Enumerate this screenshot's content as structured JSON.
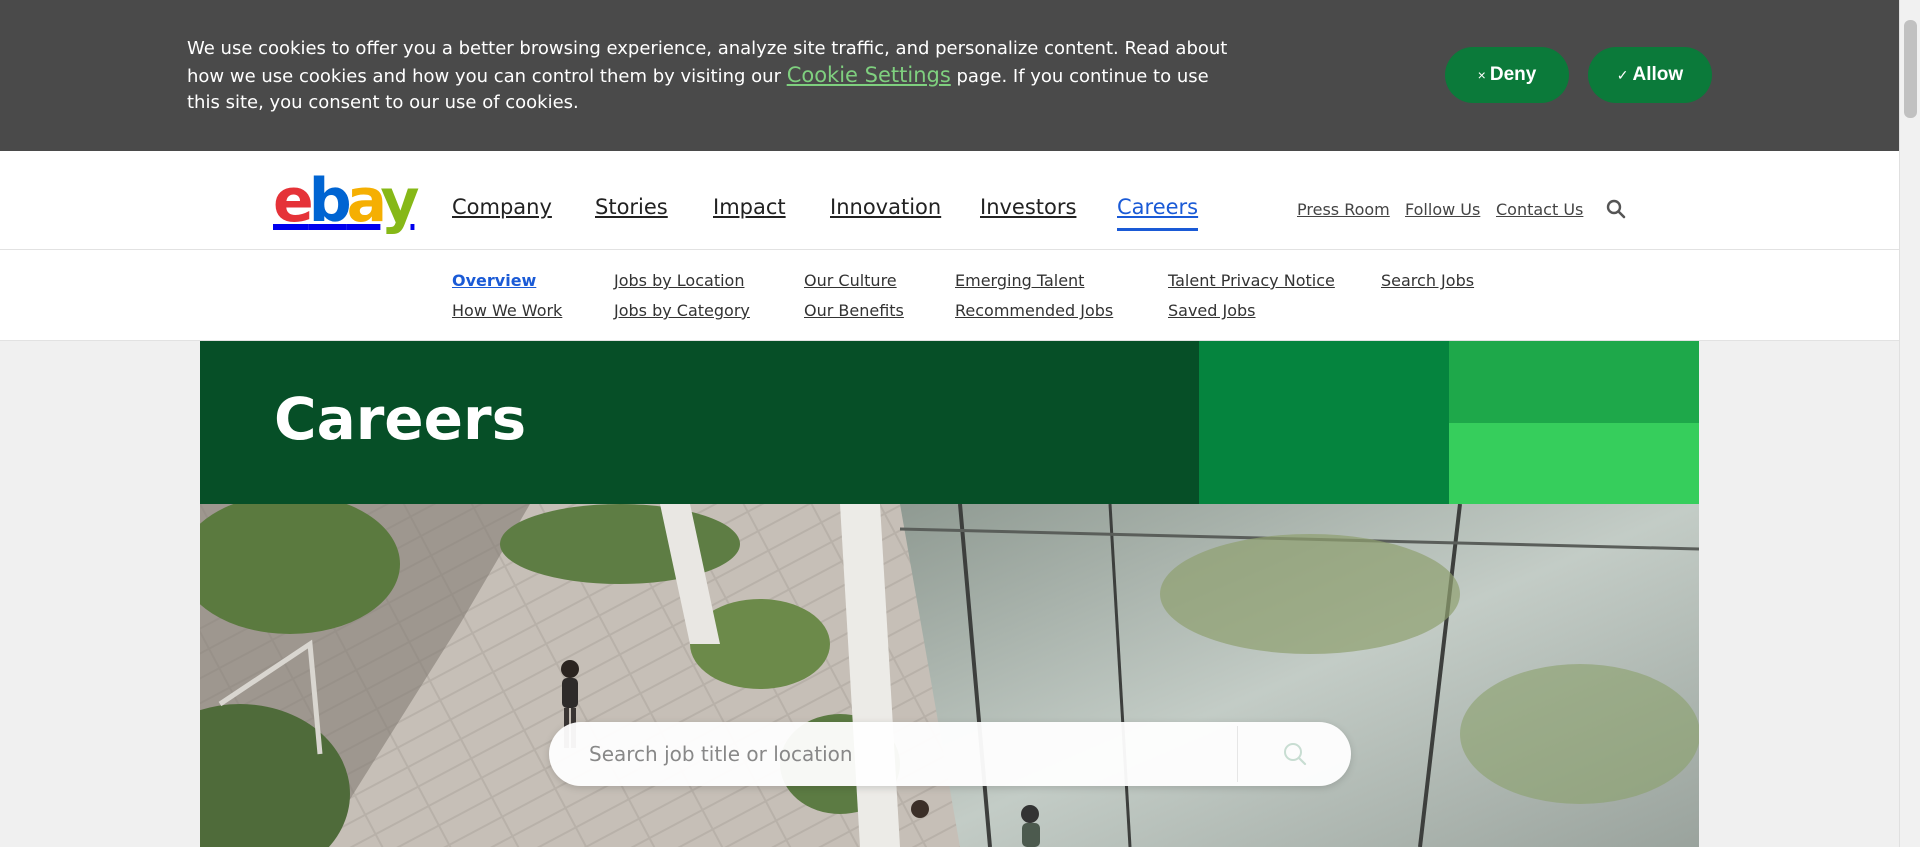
{
  "cookie_banner": {
    "text_before": "We use cookies to offer you a better browsing experience, analyze site traffic, and personalize content. Read about how we use cookies and how you can control them by visiting our ",
    "link_text": "Cookie Settings",
    "text_after": " page. If you continue to use this site, you consent to our use of cookies.",
    "deny_label": "Deny",
    "deny_icon": "×",
    "allow_label": "Allow",
    "allow_icon": "✓"
  },
  "logo": {
    "e": "e",
    "b": "b",
    "a": "a",
    "y": "y"
  },
  "main_nav": [
    {
      "label": "Company"
    },
    {
      "label": "Stories"
    },
    {
      "label": "Impact"
    },
    {
      "label": "Innovation"
    },
    {
      "label": "Investors"
    },
    {
      "label": "Careers",
      "active": true
    }
  ],
  "util_nav": [
    {
      "label": "Press Room"
    },
    {
      "label": "Follow Us"
    },
    {
      "label": "Contact Us"
    }
  ],
  "sub_nav": [
    {
      "label": "Overview",
      "active": true
    },
    {
      "label": "How We Work"
    },
    {
      "label": "Jobs by Location"
    },
    {
      "label": "Jobs by Category"
    },
    {
      "label": "Our Culture"
    },
    {
      "label": "Our Benefits"
    },
    {
      "label": "Emerging Talent"
    },
    {
      "label": "Recommended Jobs"
    },
    {
      "label": "Talent Privacy Notice"
    },
    {
      "label": "Saved Jobs"
    },
    {
      "label": "Search Jobs"
    }
  ],
  "hero": {
    "title": "Careers",
    "search_placeholder": "Search job title or location"
  },
  "colors": {
    "accent_blue": "#1a5ad6",
    "brand_dark_green": "#064f27",
    "brand_green": "#05843e",
    "brand_mid_green": "#1ea84a",
    "brand_light_green": "#36ce5c",
    "button_green": "#0b7a3a"
  }
}
